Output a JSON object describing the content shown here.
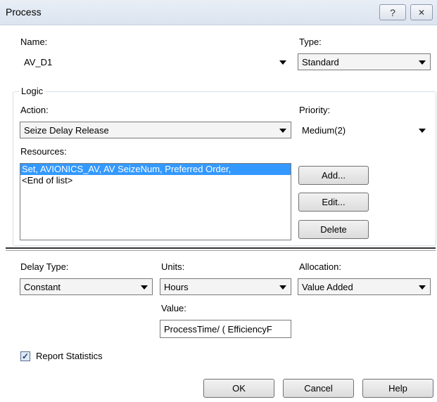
{
  "window": {
    "title": "Process",
    "help_glyph": "?",
    "close_glyph": "✕"
  },
  "name": {
    "label": "Name:",
    "value": "AV_D1"
  },
  "type": {
    "label": "Type:",
    "value": "Standard"
  },
  "logic": {
    "group_label": "Logic",
    "action": {
      "label": "Action:",
      "value": "Seize Delay Release"
    },
    "priority": {
      "label": "Priority:",
      "value": "Medium(2)"
    },
    "resources": {
      "label": "Resources:",
      "items": [
        {
          "text": "Set, AVIONICS_AV, AV SeizeNum, Preferred Order,",
          "selected": true
        },
        {
          "text": "<End of list>",
          "selected": false
        }
      ]
    },
    "buttons": {
      "add": "Add...",
      "edit": "Edit...",
      "delete": "Delete"
    }
  },
  "delay": {
    "delay_type": {
      "label": "Delay Type:",
      "value": "Constant"
    },
    "units": {
      "label": "Units:",
      "value": "Hours"
    },
    "allocation": {
      "label": "Allocation:",
      "value": "Value Added"
    },
    "value": {
      "label": "Value:",
      "value": "ProcessTime/ ( EfficiencyF"
    }
  },
  "report_statistics": {
    "label": "Report Statistics",
    "checked": true,
    "glyph": "✓"
  },
  "footer": {
    "ok": "OK",
    "cancel": "Cancel",
    "help": "Help"
  },
  "colors": {
    "selection": "#3399ff",
    "title_bar": "#dbe4f0"
  }
}
